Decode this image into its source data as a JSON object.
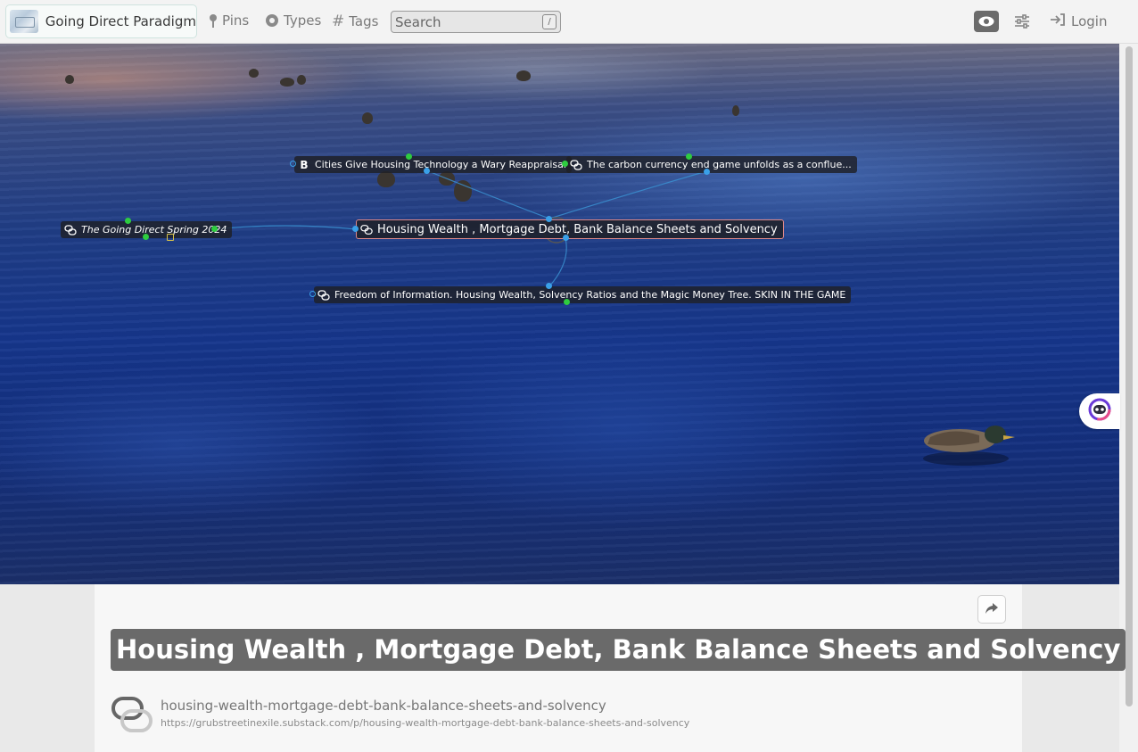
{
  "header": {
    "brand_name": "Going Direct Paradigm",
    "nav": [
      {
        "label": "Pins",
        "icon": "pin-icon"
      },
      {
        "label": "Types",
        "icon": "circle-icon"
      },
      {
        "label": "Tags",
        "icon": "hash-icon"
      }
    ],
    "search_placeholder": "Search",
    "search_shortcut": "/",
    "login_label": "Login"
  },
  "graph": {
    "central_node": "Housing Wealth , Mortgage Debt, Bank Balance Sheets and Solvency",
    "nodes": [
      {
        "label": "Cities Give Housing Technology a Wary Reappraisal",
        "icon": "bold-b-icon"
      },
      {
        "label": "The carbon currency end game unfolds as a conflue...",
        "icon": "link-icon"
      },
      {
        "label": "The Going Direct Spring 2024",
        "icon": "link-icon"
      },
      {
        "label": "Freedom of Information. Housing Wealth, Solvency Ratios and the Magic Money Tree. SKIN IN THE GAME",
        "icon": "link-icon"
      }
    ]
  },
  "article": {
    "title": "Housing Wealth , Mortgage Debt, Bank Balance Sheets and Solvency",
    "slug": "housing-wealth-mortgage-debt-bank-balance-sheets-and-solvency",
    "url": "https://grubstreetinexile.substack.com/p/housing-wealth-mortgage-debt-bank-balance-sheets-and-solvency"
  },
  "colors": {
    "accent_green": "#2ecc40",
    "accent_blue": "#3aa0e8",
    "central_border": "#e08a8a"
  }
}
